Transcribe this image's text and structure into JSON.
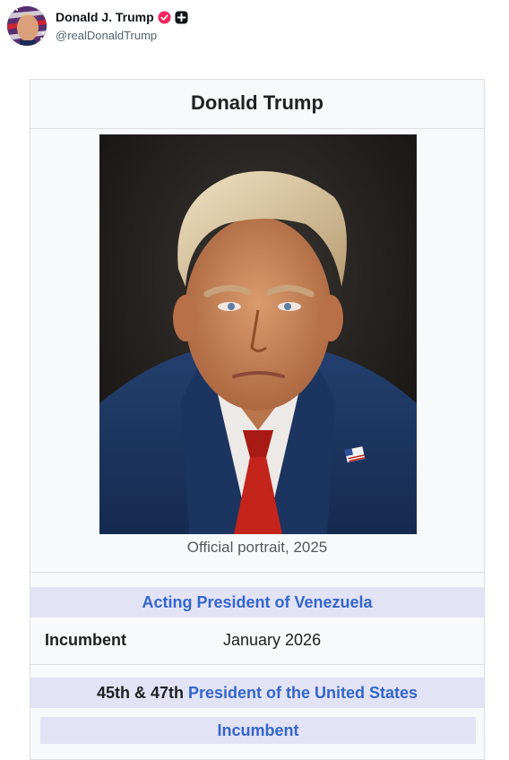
{
  "post": {
    "display_name": "Donald J. Trump",
    "handle": "@realDonaldTrump",
    "verified_badge_icon": "verified-badge-icon",
    "affiliate_badge_icon": "affiliate-badge-icon",
    "badge_color": "#f4245e"
  },
  "infobox": {
    "title": "Donald Trump",
    "portrait_caption": "Official portrait, 2025",
    "office_1": {
      "header": "Acting President of Venezuela",
      "rows": [
        {
          "label": "Incumbent",
          "value": "January 2026"
        }
      ]
    },
    "office_2": {
      "header_prefix": "45th & 47th",
      "header_link": "President of the United States",
      "sub_header": "Incumbent"
    },
    "colors": {
      "section_header_bg": "#e3e3f6",
      "link": "#3366cc",
      "box_bg": "#f8f9fa"
    }
  }
}
